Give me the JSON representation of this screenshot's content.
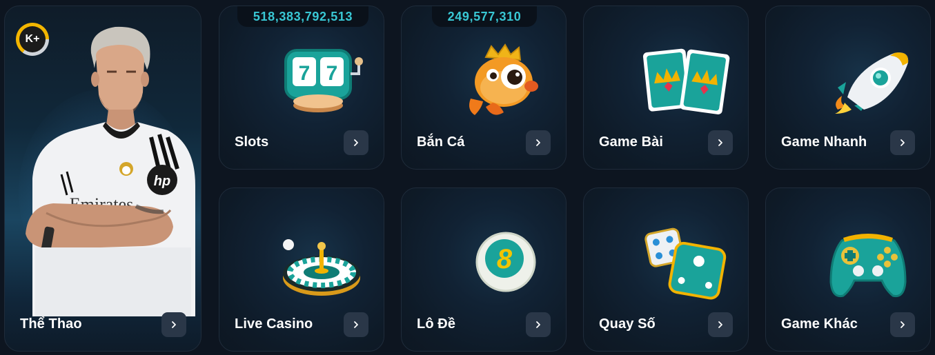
{
  "featured": {
    "label": "Thể Thao",
    "logo_text": "K+",
    "shirt_sponsor": "Emirates",
    "shirt_brand": "hp"
  },
  "cards": [
    {
      "label": "Slots",
      "jackpot": "518,383,792,513",
      "icon": "slot-machine-icon",
      "machine_digits": "77"
    },
    {
      "label": "Bắn Cá",
      "jackpot": "249,577,310",
      "icon": "fish-icon"
    },
    {
      "label": "Game Bài",
      "icon": "playing-cards-icon"
    },
    {
      "label": "Game Nhanh",
      "icon": "rocket-icon"
    },
    {
      "label": "Live Casino",
      "icon": "roulette-icon"
    },
    {
      "label": "Lô Đề",
      "icon": "lottery-ball-icon",
      "ball_number": "8"
    },
    {
      "label": "Quay Số",
      "icon": "dice-icon"
    },
    {
      "label": "Game Khác",
      "icon": "gamepad-icon"
    }
  ],
  "colors": {
    "background": "#0d1520",
    "card_border": "#1f2c3b",
    "jackpot_text": "#39c7d4",
    "arrow_button": "#2a3748",
    "accent_teal": "#1aa39a",
    "accent_gold": "#f2b300"
  }
}
